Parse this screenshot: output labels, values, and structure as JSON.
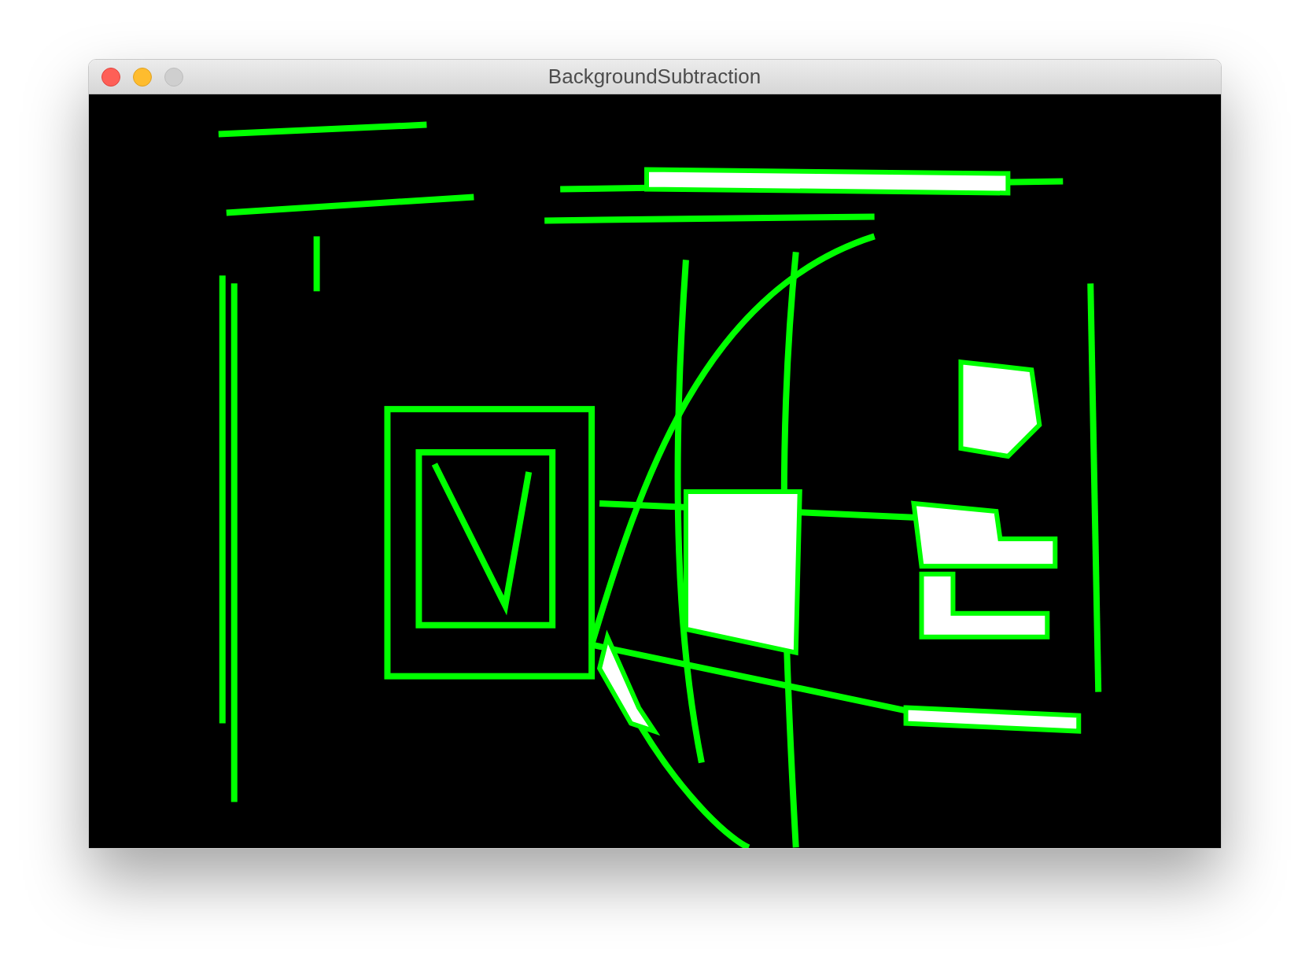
{
  "window": {
    "title": "BackgroundSubtraction"
  }
}
